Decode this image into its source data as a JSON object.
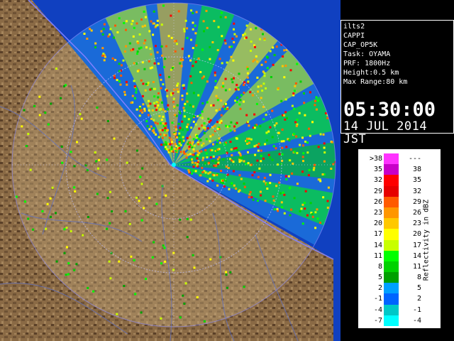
{
  "info": {
    "lines": [
      "ilts2",
      "CAPPI",
      "CAP_OP5K",
      "Task: OYAMA",
      "PRF: 1800Hz",
      "Height:0.5 km",
      "Max Range:80 km"
    ],
    "time": "05:30:00",
    "date": "14 JUL 2014 JST"
  },
  "legend": {
    "title": "Reflectivity in dBZ",
    "rows": [
      {
        "lo": ">38",
        "hi": "---",
        "color": "#ff33ff"
      },
      {
        "lo": "35",
        "hi": "38",
        "color": "#c800c8"
      },
      {
        "lo": "32",
        "hi": "35",
        "color": "#ff0000"
      },
      {
        "lo": "29",
        "hi": "32",
        "color": "#e60000"
      },
      {
        "lo": "26",
        "hi": "29",
        "color": "#ff5a00"
      },
      {
        "lo": "23",
        "hi": "26",
        "color": "#ff9600"
      },
      {
        "lo": "20",
        "hi": "23",
        "color": "#ffc800"
      },
      {
        "lo": "17",
        "hi": "20",
        "color": "#ffff00"
      },
      {
        "lo": "14",
        "hi": "17",
        "color": "#c8ff00"
      },
      {
        "lo": "11",
        "hi": "14",
        "color": "#00ff00"
      },
      {
        "lo": "8",
        "hi": "11",
        "color": "#00d200"
      },
      {
        "lo": "5",
        "hi": "8",
        "color": "#00a000"
      },
      {
        "lo": "2",
        "hi": "5",
        "color": "#00a0ff"
      },
      {
        "lo": "-1",
        "hi": "2",
        "color": "#0064ff"
      },
      {
        "lo": "-4",
        "hi": "-1",
        "color": "#00c8c8"
      },
      {
        "lo": "-7",
        "hi": "-4",
        "color": "#00ffff"
      }
    ]
  },
  "map_colors": {
    "sea": "#1040c0",
    "land": "#8a6a45",
    "land_dark": "#5a4028",
    "coastline": "#8080ff",
    "range_ring": "#9090ff"
  }
}
